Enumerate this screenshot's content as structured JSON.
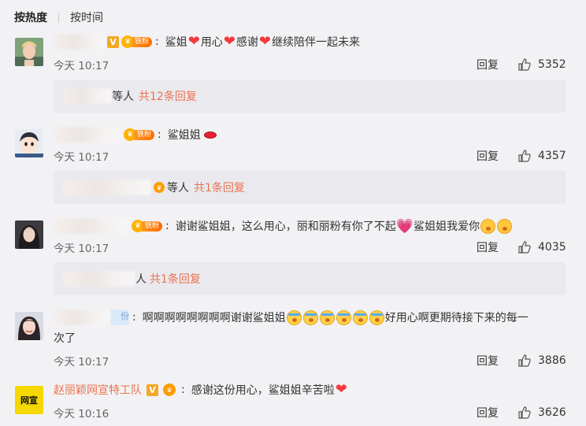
{
  "sort": {
    "hot": "按热度",
    "time": "按时间"
  },
  "fan_tag": "铁粉",
  "comments": [
    {
      "avatar": "avatar-blonde-man",
      "parts": [
        "鲨姐",
        "用心",
        "感谢",
        "继续陪伴一起未来"
      ],
      "time": "今天 10:17",
      "reply_label": "回复",
      "likes": "5352",
      "replies": {
        "suffix": "等人",
        "count": "共12条回复"
      }
    },
    {
      "avatar": "avatar-cartoon-boy",
      "text": "鲨姐姐",
      "time": "今天 10:17",
      "reply_label": "回复",
      "likes": "4357",
      "replies": {
        "suffix": "等人",
        "count": "共1条回复"
      }
    },
    {
      "avatar": "avatar-woman-dark",
      "text_a": "谢谢鲨姐姐，这么用心，丽和丽粉有你了不起",
      "text_b": "鲨姐姐我爱你",
      "time": "今天 10:17",
      "reply_label": "回复",
      "likes": "4035",
      "replies": {
        "suffix": "人",
        "count": "共1条回复"
      }
    },
    {
      "avatar": "avatar-woman-smile",
      "name_fragment": "份",
      "text_a": "啊啊啊啊啊啊啊啊谢谢鲨姐姐",
      "text_b": "好用心啊更期待接下来的每一",
      "text_c": "次了",
      "time": "今天 10:17",
      "reply_label": "回复",
      "likes": "3886"
    },
    {
      "avatar": "avatar-logo-yellow",
      "avatar_text": "网宣",
      "name": "赵丽颖网宣特工队",
      "text": "感谢这份用心，鲨姐姐辛苦啦",
      "time": "今天 10:16",
      "reply_label": "回复",
      "likes": "3626"
    }
  ],
  "colors": {
    "accent": "#eb7350",
    "heart": "#f33b3b",
    "bg": "#f2f2f5",
    "reply_bg": "#e9e9ee"
  }
}
